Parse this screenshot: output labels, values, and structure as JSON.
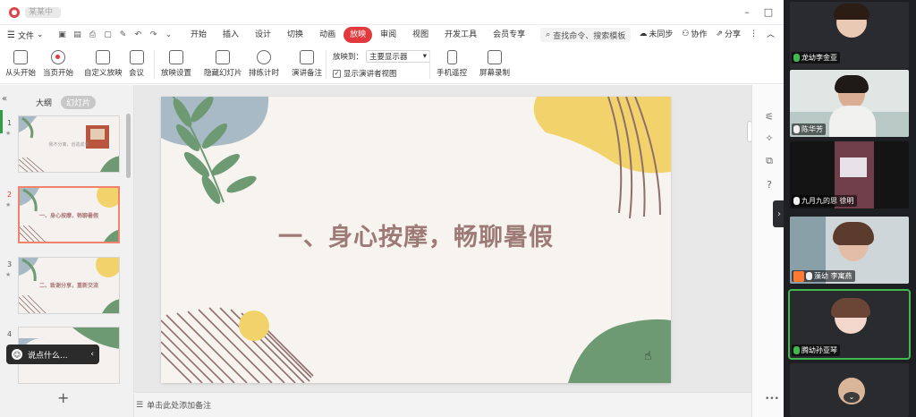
{
  "window": {
    "doc_title": "某某中"
  },
  "menu": {
    "file_label": "文件",
    "tabs": [
      "开始",
      "插入",
      "设计",
      "切换",
      "动画",
      "放映",
      "审阅",
      "视图",
      "开发工具",
      "会员专享"
    ],
    "active_tab": "放映",
    "search_placeholder": "查找命令、搜索模板",
    "sync_label": "未同步",
    "collab_label": "协作",
    "share_label": "分享"
  },
  "ribbon": {
    "from_start": "从头开始",
    "from_current": "当页开始",
    "custom_show": "自定义放映",
    "meeting": "会议",
    "show_settings": "放映设置",
    "hide_slide": "隐藏幻灯片",
    "rehearse": "排练计时",
    "presenter_notes": "演讲备注",
    "show_to_label": "放映到：",
    "show_to_value": "主要显示器",
    "presenter_view": "显示演讲者视图",
    "phone_remote": "手机遥控",
    "screen_record": "屏幕录制"
  },
  "left_panel": {
    "tab_outline": "大纲",
    "tab_slides": "幻灯片",
    "thumbnails": [
      {
        "num": "1",
        "text": "我不分离，创造成长"
      },
      {
        "num": "2",
        "text": "一、身心按摩，畅聊暑假"
      },
      {
        "num": "3",
        "text": "二、致谢分享，重新交流"
      },
      {
        "num": "4",
        "text": ""
      }
    ],
    "chat_placeholder": "说点什么..."
  },
  "slide": {
    "title": "一、身心按摩，畅聊暑假"
  },
  "notes": {
    "placeholder": "单击此处添加备注"
  },
  "participants": [
    {
      "name": "龙幼李金亚",
      "mic": "on"
    },
    {
      "name": "陈华芳",
      "mic": "off"
    },
    {
      "name": "九月九的思  徐明",
      "mic": "off"
    },
    {
      "name": "藻幼 李寓燕",
      "mic": "off"
    },
    {
      "name": "腾幼孙亚琴",
      "mic": "on"
    }
  ],
  "colors": {
    "accent": "#e4393c",
    "slide_title": "#9e7a76",
    "leaf_green": "#6e9a73",
    "blob_yellow": "#f2d36b",
    "blob_blue": "#a9bac7",
    "stripe_brown": "#8e6f6c"
  }
}
